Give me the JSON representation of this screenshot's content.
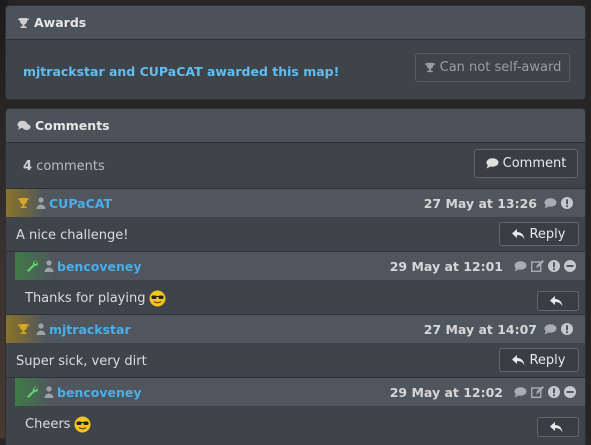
{
  "awards": {
    "title": "Awards",
    "text": "mjtrackstar and CUPaCAT awarded this map!",
    "self_award_label": "Can not self-award"
  },
  "comments": {
    "title": "Comments",
    "count_number": "4",
    "count_word": "comments",
    "comment_button_label": "Comment",
    "reply_label": "Reply",
    "items": [
      {
        "user": "CUPaCAT",
        "date": "27 May at 13:26",
        "text": "A nice challenge!",
        "badge": "trophy-icon"
      },
      {
        "user": "bencoveney",
        "date": "29 May at 12:01",
        "text": "Thanks for playing",
        "badge": "wrench-icon"
      },
      {
        "user": "mjtrackstar",
        "date": "27 May at 14:07",
        "text": "Super sick, very dirt",
        "badge": "trophy-icon"
      },
      {
        "user": "bencoveney",
        "date": "29 May at 12:02",
        "text": "Cheers",
        "badge": "wrench-icon"
      }
    ]
  },
  "colors": {
    "username": "#4aaee8",
    "awarded_text": "#5fbdf2",
    "trophy": "#d4a820",
    "wrench": "#5cd66a"
  }
}
